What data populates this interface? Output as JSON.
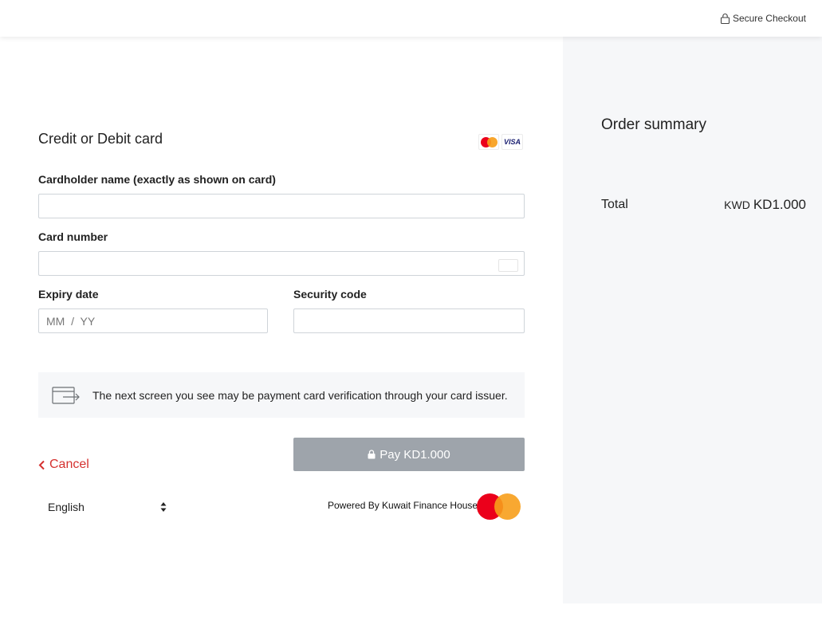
{
  "header": {
    "secure_label": "Secure Checkout",
    "lock_icon": "lock-icon"
  },
  "payment_form": {
    "title": "Credit or Debit card",
    "card_brands": [
      "Mastercard",
      "VISA"
    ],
    "cardholder": {
      "label": "Cardholder name (exactly as shown on card)",
      "value": "",
      "placeholder": ""
    },
    "card_number": {
      "label": "Card number",
      "value": "",
      "placeholder": ""
    },
    "expiry": {
      "label": "Expiry date",
      "value": "",
      "placeholder": "MM  /  YY"
    },
    "security_code": {
      "label": "Security code",
      "value": "",
      "placeholder": ""
    },
    "notice": {
      "text": "The next screen you see may be payment card verification through your card issuer.",
      "icon": "card-redirect-icon"
    },
    "cancel_label": "Cancel",
    "pay_label": "Pay KD1.000"
  },
  "footer": {
    "language": "English",
    "powered_by": "Powered By Kuwait Finance House",
    "brand_logo": "mastercard-logo"
  },
  "order_summary": {
    "title": "Order summary",
    "total_label": "Total",
    "currency_code": "KWD",
    "total_amount": "KD1.000"
  },
  "colors": {
    "accent_cancel": "#d5312f",
    "pay_button_disabled": "#9ea4ab",
    "summary_background": "#f6f7f9",
    "mastercard_red": "#eb001b",
    "mastercard_orange": "#f79e1b"
  }
}
